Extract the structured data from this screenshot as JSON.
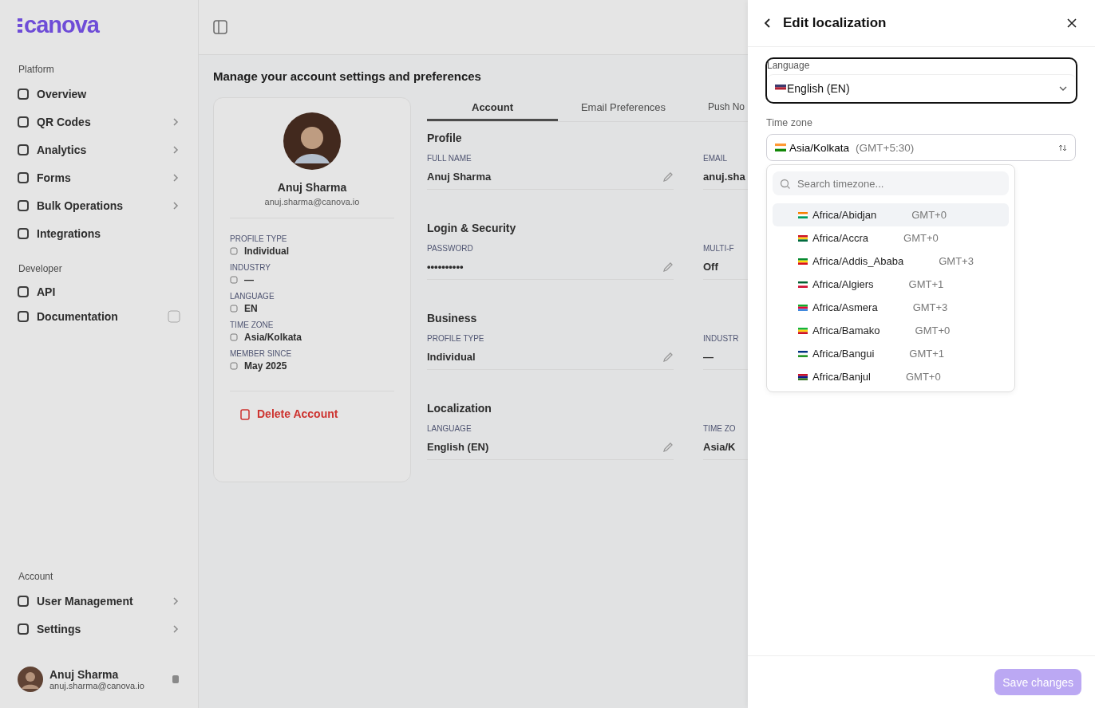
{
  "sidebar": {
    "logo": "canova",
    "sections": [
      {
        "title": "Platform",
        "items": [
          {
            "label": "Overview",
            "kind": "page"
          },
          {
            "label": "QR Codes",
            "kind": "group"
          },
          {
            "label": "Analytics",
            "kind": "group"
          },
          {
            "label": "Forms",
            "kind": "group"
          },
          {
            "label": "Bulk Operations",
            "kind": "group"
          },
          {
            "label": "Integrations",
            "kind": "page"
          }
        ]
      },
      {
        "title": "Developer",
        "items": [
          {
            "label": "API",
            "kind": "page"
          },
          {
            "label": "Documentation",
            "kind": "external"
          }
        ]
      },
      {
        "title": "Account",
        "items": [
          {
            "label": "User Management",
            "kind": "group"
          },
          {
            "label": "Settings",
            "kind": "group"
          }
        ]
      }
    ],
    "user": {
      "name": "Anuj Sharma",
      "email": "anuj.sharma@canova.io"
    }
  },
  "main": {
    "subtitle": "Manage your account settings and preferences",
    "profile_card": {
      "name": "Anuj Sharma",
      "email": "anuj.sharma@canova.io",
      "facts": [
        {
          "label": "PROFILE TYPE",
          "value": "Individual"
        },
        {
          "label": "INDUSTRY",
          "value": "—"
        },
        {
          "label": "LANGUAGE",
          "value": "EN"
        },
        {
          "label": "TIME ZONE",
          "value": "Asia/Kolkata"
        },
        {
          "label": "MEMBER SINCE",
          "value": "May 2025"
        }
      ],
      "delete": "Delete Account"
    },
    "tabs": [
      {
        "label": "Account",
        "selected": true
      },
      {
        "label": "Email Preferences",
        "selected": false
      },
      {
        "label": "Push No",
        "selected": false
      }
    ],
    "sections": [
      {
        "title": "Profile",
        "fields": [
          {
            "label": "FULL NAME",
            "value": "Anuj Sharma"
          },
          {
            "label": "EMAIL",
            "value": "anuj.sha"
          }
        ]
      },
      {
        "title": "Login & Security",
        "fields": [
          {
            "label": "PASSWORD",
            "value": "••••••••••"
          },
          {
            "label": "MULTI-F",
            "value": "Off"
          }
        ]
      },
      {
        "title": "Business",
        "fields": [
          {
            "label": "PROFILE TYPE",
            "value": "Individual"
          },
          {
            "label": "INDUSTR",
            "value": "—"
          }
        ]
      },
      {
        "title": "Localization",
        "fields": [
          {
            "label": "LANGUAGE",
            "value": "English (EN)"
          },
          {
            "label": "TIME ZO",
            "value": "Asia/K"
          }
        ]
      }
    ]
  },
  "drawer": {
    "title": "Edit localization",
    "language": {
      "label": "Language",
      "value": "English (EN)",
      "focused": true
    },
    "timezone": {
      "label": "Time zone",
      "value": "Asia/Kolkata",
      "offset": "(GMT+5:30)",
      "expanded": true
    },
    "popup": {
      "placeholder": "Search timezone...",
      "options": [
        {
          "name": "Africa/Abidjan",
          "offset": "GMT+0",
          "selected": true
        },
        {
          "name": "Africa/Accra",
          "offset": "GMT+0",
          "selected": false
        },
        {
          "name": "Africa/Addis_Ababa",
          "offset": "GMT+3",
          "selected": false
        },
        {
          "name": "Africa/Algiers",
          "offset": "GMT+1",
          "selected": false
        },
        {
          "name": "Africa/Asmera",
          "offset": "GMT+3",
          "selected": false
        },
        {
          "name": "Africa/Bamako",
          "offset": "GMT+0",
          "selected": false
        },
        {
          "name": "Africa/Bangui",
          "offset": "GMT+1",
          "selected": false
        },
        {
          "name": "Africa/Banjul",
          "offset": "GMT+0",
          "selected": false
        }
      ]
    },
    "save": {
      "label": "Save changes",
      "disabled": true
    }
  }
}
